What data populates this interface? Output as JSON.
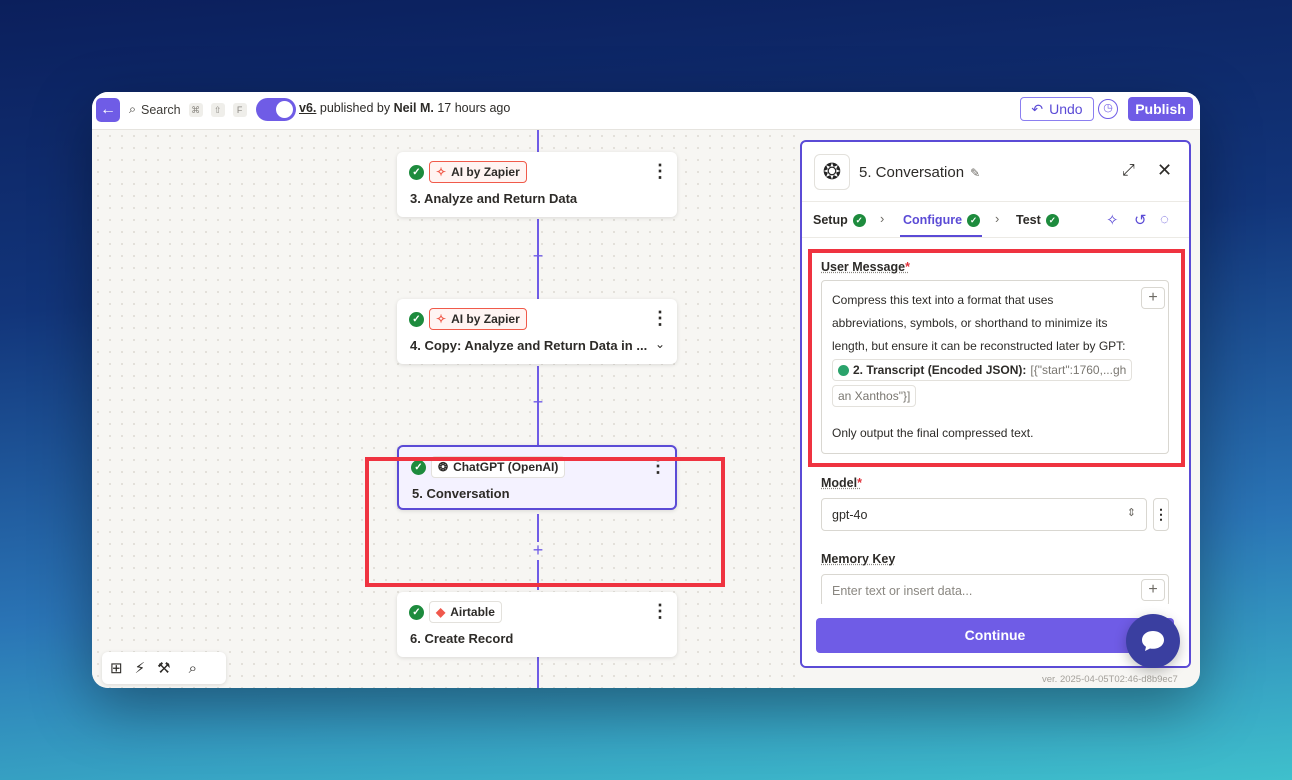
{
  "topbar": {
    "search_label": "Search",
    "shortcut_keys": [
      "⌘",
      "⇧",
      "F"
    ],
    "version": "v6.",
    "published_by": "published by",
    "author": "Neil M.",
    "time_ago": "17 hours ago",
    "undo_label": "Undo",
    "publish_label": "Publish"
  },
  "steps": [
    {
      "app": "AI by Zapier",
      "number": "3.",
      "title": "Analyze and Return Data"
    },
    {
      "app": "AI by Zapier",
      "number": "4.",
      "title": "Copy: Analyze and Return Data in ..."
    },
    {
      "app": "ChatGPT (OpenAI)",
      "number": "5.",
      "title": "Conversation"
    },
    {
      "app": "Airtable",
      "number": "6.",
      "title": "Create Record"
    }
  ],
  "panel": {
    "title": "5. Conversation",
    "tabs": [
      {
        "label": "Setup"
      },
      {
        "label": "Configure"
      },
      {
        "label": "Test"
      }
    ],
    "user_message": {
      "label": "User Message",
      "required_mark": "*",
      "line1": "Compress this text into a format that uses",
      "line2": "abbreviations, symbols, or shorthand to minimize its",
      "line3": "length, but ensure it can be reconstructed later by GPT:",
      "pill_name": "2. Transcript (Encoded JSON):",
      "pill_value": "[{\"start\":1760,...gh",
      "pill_value_cont": "an Xanthos\"}]",
      "line_final": "Only output the final compressed text."
    },
    "model": {
      "label": "Model",
      "required_mark": "*",
      "value": "gpt-4o"
    },
    "memory_key": {
      "label": "Memory Key",
      "placeholder": "Enter text or insert data..."
    },
    "continue_label": "Continue"
  },
  "footer_version": "ver. 2025-04-05T02:46-d8b9ec7",
  "colors": {
    "accent": "#6f5ce6",
    "highlight": "#ef3340",
    "success": "#1d8b3d"
  }
}
